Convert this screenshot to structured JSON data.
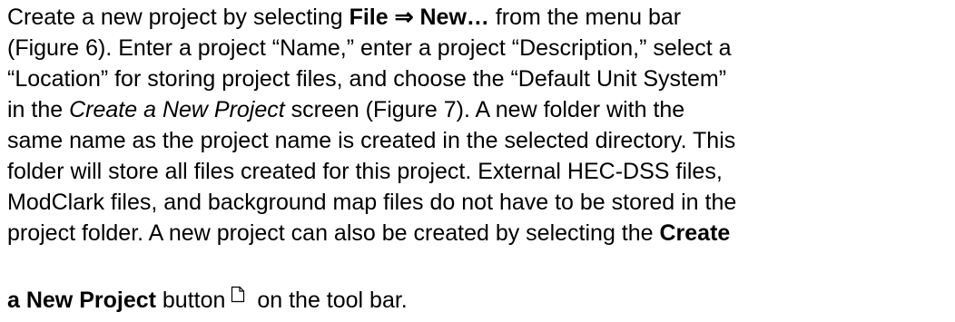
{
  "paragraph": {
    "l1": {
      "a": "Create a new project by selecting ",
      "b": "File ⇒ New…",
      "c": " from the menu bar"
    },
    "l2": "(Figure 6).  Enter a project “Name,” enter a project “Description,” select a",
    "l3": "“Location” for storing project files, and choose the “Default Unit System”",
    "l4": {
      "a": "in the ",
      "i": "Create a New Project",
      "c": " screen (Figure 7).  A new folder with the"
    },
    "l5": "same name as the project name is created in the selected directory.  This",
    "l6": "folder will store all files created for this project.  External HEC-DSS files,",
    "l7": "ModClark files, and background map files do not have to be stored in the",
    "l8": {
      "a": "project folder.  A new project can also be created by selecting the ",
      "b": "Create"
    },
    "l9": {
      "b": "a New Project",
      "a": " button",
      "c": " on the tool bar."
    }
  },
  "icon": "new-document-icon"
}
